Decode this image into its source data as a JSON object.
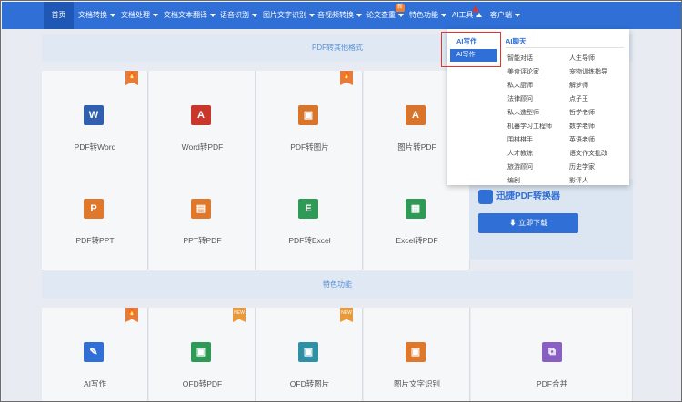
{
  "nav": {
    "items": [
      {
        "label": "首页"
      },
      {
        "label": "文档转换"
      },
      {
        "label": "文档处理"
      },
      {
        "label": "文档文本翻译"
      },
      {
        "label": "语音识别"
      },
      {
        "label": "图片文字识别"
      },
      {
        "label": "音视频转换"
      },
      {
        "label": "论文查重"
      },
      {
        "label": "特色功能"
      },
      {
        "label": "AI工具"
      },
      {
        "label": "客户端"
      }
    ],
    "new_badge": "新"
  },
  "sections": {
    "pdf_other": "PDF转其他格式",
    "featured": "特色功能"
  },
  "cards_row1": [
    {
      "label": "PDF转Word",
      "icon_text": "W",
      "color": "#2f5fae",
      "flag": "hot"
    },
    {
      "label": "Word转PDF",
      "icon_text": "A",
      "color": "#c9372c",
      "flag": ""
    },
    {
      "label": "PDF转图片",
      "icon_text": "▣",
      "color": "#d9742c",
      "flag": "hot"
    },
    {
      "label": "图片转PDF",
      "icon_text": "A",
      "color": "#d9742c",
      "flag": ""
    }
  ],
  "cards_row2": [
    {
      "label": "PDF转PPT",
      "icon_text": "P",
      "color": "#e0782c",
      "flag": ""
    },
    {
      "label": "PPT转PDF",
      "icon_text": "▤",
      "color": "#e0782c",
      "flag": ""
    },
    {
      "label": "PDF转Excel",
      "icon_text": "E",
      "color": "#2e9a55",
      "flag": ""
    },
    {
      "label": "Excel转PDF",
      "icon_text": "▦",
      "color": "#2e9a55",
      "flag": ""
    }
  ],
  "cards_row3": [
    {
      "label": "AI写作",
      "icon_text": "✎",
      "color": "#2f6fd6",
      "flag": "hot"
    },
    {
      "label": "OFD转PDF",
      "icon_text": "▣",
      "color": "#2e9a55",
      "flag": "new"
    },
    {
      "label": "OFD转图片",
      "icon_text": "▣",
      "color": "#2e8fa5",
      "flag": "new"
    },
    {
      "label": "图片文字识别",
      "icon_text": "▣",
      "color": "#e0782c",
      "flag": ""
    },
    {
      "label": "PDF合并",
      "icon_text": "⧉",
      "color": "#8a5fc4",
      "flag": ""
    }
  ],
  "flags": {
    "new": "NEW"
  },
  "promo": {
    "title": "迅捷PDF转换器",
    "button": "⬇ 立即下载"
  },
  "dropdown": {
    "left_head": "AI写作",
    "left_active": "AI写作",
    "right_head": "AI聊天",
    "col1": [
      "智能对话",
      "美食评论家",
      "私人厨师",
      "法律顾问",
      "私人造型师",
      "机器学习工程师",
      "围棋棋手",
      "人才教练",
      "旅游顾问",
      "编剧"
    ],
    "col2": [
      "人生导师",
      "宠物训练指导",
      "解梦师",
      "点子王",
      "哲学老师",
      "数学老师",
      "英语老师",
      "语文作文批改",
      "历史学家",
      "影评人"
    ]
  }
}
